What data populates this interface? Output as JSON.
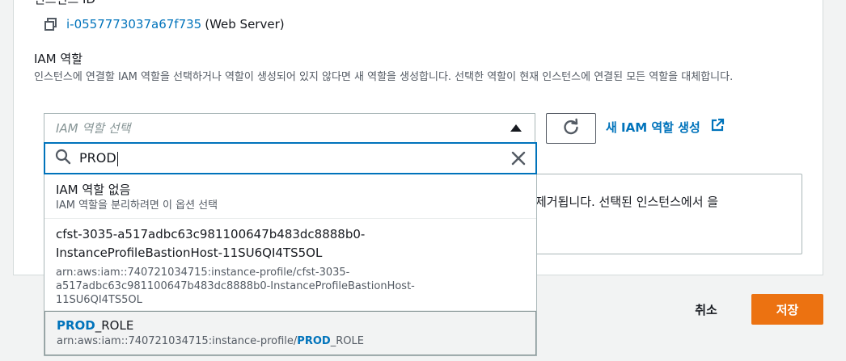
{
  "instance": {
    "section_label": "인스턴스 ID",
    "id_link": "i-0557773037a67f735",
    "suffix": "(Web Server)",
    "copy_icon": "copy-icon"
  },
  "iam": {
    "label": "IAM 역할",
    "description": "인스턴스에 연결할 IAM 역할을 선택하거나 역할이 생성되어 있지 않다면 새 역할을 생성합니다. 선택한 역할이 현재 인스턴스에 연결된 모든 역할을 대체합니다.",
    "select_placeholder": "IAM 역할 선택",
    "create_link": "새 IAM 역할 생성",
    "refresh_icon": "refresh-icon",
    "external_icon": "external-link-icon"
  },
  "search": {
    "value": "PROD",
    "clear_icon": "close-icon",
    "search_icon": "search-icon"
  },
  "options": {
    "none": {
      "title": "IAM 역할 없음",
      "subtitle": "IAM 역할을 분리하려면 이 옵션 선택"
    },
    "cfst": {
      "title_line1": "cfst-3035-a517adbc63c981100647b483dc8888b0-",
      "title_line2": "InstanceProfileBastionHost-11SU6QI4TS5OL",
      "arn_line1": "arn:aws:iam::740721034715:instance-profile/cfst-3035-",
      "arn_line2": "a517adbc63c981100647b483dc8888b0-InstanceProfileBastionHost-",
      "arn_line3": "11SU6QI4TS5OL"
    },
    "prod": {
      "title_match": "PROD",
      "title_rest": "_ROLE",
      "arn_prefix": "arn:aws:iam::740721034715:instance-profile/",
      "arn_match": "PROD",
      "arn_rest": "_ROLE"
    }
  },
  "behind_text": "제거됩니다. 선택된 인스턴스에서 을",
  "footer": {
    "cancel": "취소",
    "save": "저장"
  },
  "colors": {
    "link": "#0073bb",
    "primary": "#ec7211"
  }
}
